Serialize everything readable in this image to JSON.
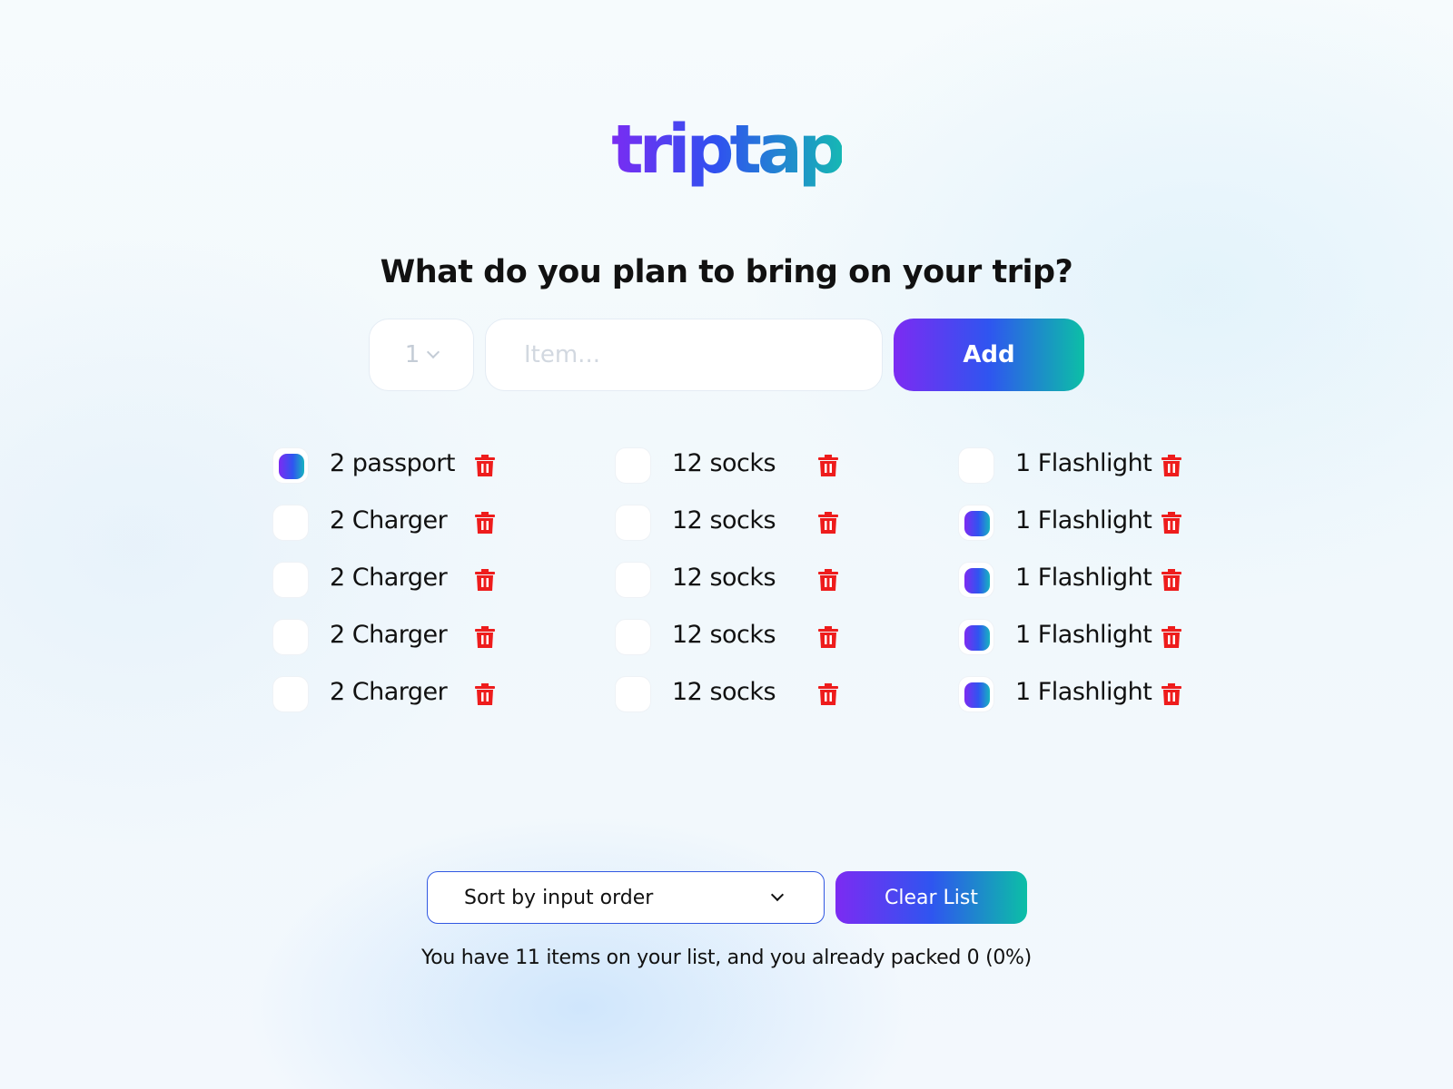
{
  "app": {
    "logo_text": "triptap",
    "question": "What do you plan to bring on your trip?"
  },
  "form": {
    "quantity_value": "1",
    "item_placeholder": "Item...",
    "item_value": "",
    "add_label": "Add"
  },
  "columns": [
    {
      "items": [
        {
          "label": "2 passport",
          "checked": true
        },
        {
          "label": "2 Charger",
          "checked": false
        },
        {
          "label": "2 Charger",
          "checked": false
        },
        {
          "label": "2 Charger",
          "checked": false
        },
        {
          "label": "2 Charger",
          "checked": false
        }
      ]
    },
    {
      "items": [
        {
          "label": "12 socks",
          "checked": false
        },
        {
          "label": "12 socks",
          "checked": false
        },
        {
          "label": "12 socks",
          "checked": false
        },
        {
          "label": "12 socks",
          "checked": false
        },
        {
          "label": "12 socks",
          "checked": false
        }
      ]
    },
    {
      "items": [
        {
          "label": "1 Flashlight",
          "checked": false
        },
        {
          "label": "1 Flashlight",
          "checked": true
        },
        {
          "label": "1 Flashlight",
          "checked": true
        },
        {
          "label": "1 Flashlight",
          "checked": true
        },
        {
          "label": "1 Flashlight",
          "checked": true
        }
      ]
    }
  ],
  "footer": {
    "sort_value": "Sort by input order",
    "clear_label": "Clear List",
    "stats_text": "You have 11 items on your list, and you already packed 0 (0%)"
  },
  "icons": {
    "delete": "trash-icon",
    "dropdown": "chevron-down-icon"
  },
  "colors": {
    "gradient_start": "#7c2bf2",
    "gradient_mid": "#2f55f0",
    "gradient_end": "#0cbfa6",
    "delete_red": "#ee1c1c",
    "text": "#111111"
  }
}
